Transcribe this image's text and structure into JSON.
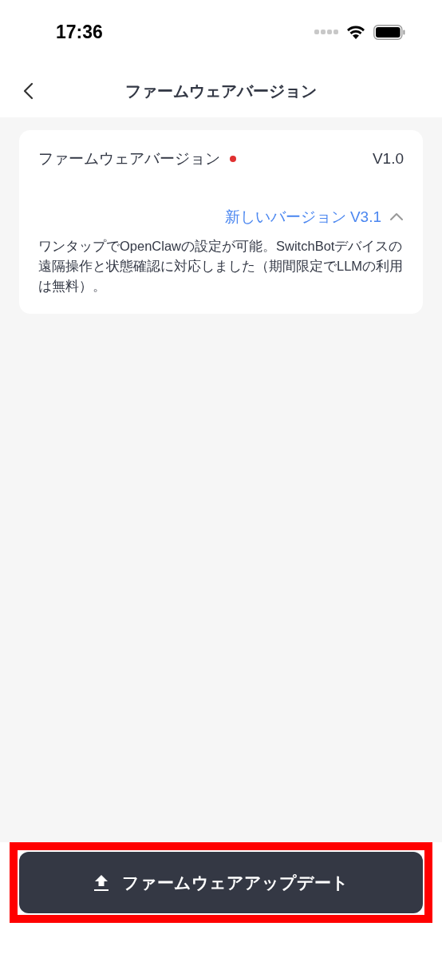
{
  "status_bar": {
    "time": "17:36"
  },
  "nav": {
    "title": "ファームウェアバージョン"
  },
  "firmware": {
    "label": "ファームウェアバージョン",
    "has_update": true,
    "current": "V1.0",
    "new_version": "新しいバージョン V3.1",
    "expanded": true,
    "notes": "ワンタップでOpenClawの設定が可能。SwitchBotデバイスの遠隔操作と状態確認に対応しました（期間限定でLLMの利用は無料）。"
  },
  "update_button": {
    "label": "ファームウェアアップデート",
    "highlighted": true
  }
}
